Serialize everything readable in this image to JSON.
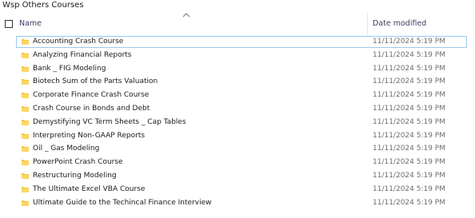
{
  "window": {
    "title": "Wsp Others Courses"
  },
  "header": {
    "name_label": "Name",
    "date_label": "Date modified",
    "sort": "ascending"
  },
  "colors": {
    "folder": "#f4c842",
    "focus_border": "#99c9ef",
    "header_text": "#3c3c64",
    "date_text": "#6d6d6d"
  },
  "rows": [
    {
      "name": "Accounting Crash Course",
      "date": "11/11/2024 5:19 PM",
      "icon": "folder-icon"
    },
    {
      "name": "Analyzing Financial Reports",
      "date": "11/11/2024 5:19 PM",
      "icon": "folder-icon"
    },
    {
      "name": "Bank _ FIG Modeling",
      "date": "11/11/2024 5:19 PM",
      "icon": "folder-icon"
    },
    {
      "name": "Biotech Sum of the Parts Valuation",
      "date": "11/11/2024 5:19 PM",
      "icon": "folder-icon"
    },
    {
      "name": "Corporate Finance Crash Course",
      "date": "11/11/2024 5:19 PM",
      "icon": "folder-icon"
    },
    {
      "name": "Crash Course in Bonds and Debt",
      "date": "11/11/2024 5:19 PM",
      "icon": "folder-icon"
    },
    {
      "name": "Demystifying VC Term Sheets _ Cap Tables",
      "date": "11/11/2024 5:19 PM",
      "icon": "folder-icon"
    },
    {
      "name": "Interpreting Non-GAAP Reports",
      "date": "11/11/2024 5:19 PM",
      "icon": "folder-icon"
    },
    {
      "name": "Oil _ Gas Modeling",
      "date": "11/11/2024 5:19 PM",
      "icon": "folder-icon"
    },
    {
      "name": "PowerPoint Crash Course",
      "date": "11/11/2024 5:19 PM",
      "icon": "folder-icon"
    },
    {
      "name": "Restructuring Modeling",
      "date": "11/11/2024 5:19 PM",
      "icon": "folder-icon"
    },
    {
      "name": "The Ultimate Excel VBA Course",
      "date": "11/11/2024 5:19 PM",
      "icon": "folder-icon"
    },
    {
      "name": "Ultimate Guide to the Techincal Finance Interview",
      "date": "11/11/2024 5:19 PM",
      "icon": "folder-icon"
    }
  ]
}
